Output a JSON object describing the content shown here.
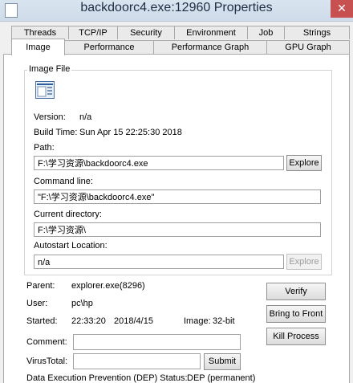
{
  "window": {
    "title": "backdoorc4.exe:12960 Properties",
    "close_glyph": "✕"
  },
  "tabs_row1": [
    "Threads",
    "TCP/IP",
    "Security",
    "Environment",
    "Job",
    "Strings"
  ],
  "tabs_row2": [
    "Image",
    "Performance",
    "Performance Graph",
    "GPU Graph"
  ],
  "active_tab": "Image",
  "image_file": {
    "group_label": "Image File",
    "version_label": "Version:",
    "version_value": "n/a",
    "build_time_label": "Build Time:",
    "build_time_value": "Sun Apr 15 22:25:30 2018",
    "path_label": "Path:",
    "path_value": "F:\\学习资源\\backdoorc4.exe",
    "explore_label": "Explore",
    "command_line_label": "Command line:",
    "command_line_value": "\"F:\\学习资源\\backdoorc4.exe\"",
    "current_dir_label": "Current directory:",
    "current_dir_value": "F:\\学习资源\\",
    "autostart_label": "Autostart Location:",
    "autostart_value": "n/a",
    "autostart_explore_label": "Explore"
  },
  "process": {
    "parent_label": "Parent:",
    "parent_value": "explorer.exe(8296)",
    "user_label": "User:",
    "user_value": "pc\\hp",
    "started_label": "Started:",
    "started_time": "22:33:20",
    "started_date": "2018/4/15",
    "image_label": "Image:",
    "image_value": "32-bit",
    "comment_label": "Comment:",
    "comment_value": "",
    "virustotal_label": "VirusTotal:",
    "virustotal_value": "",
    "submit_label": "Submit",
    "dep_label": "Data Execution Prevention (DEP) Status:",
    "dep_value": "DEP (permanent)"
  },
  "buttons": {
    "verify": "Verify",
    "bring_to_front": "Bring to Front",
    "kill_process": "Kill Process"
  }
}
